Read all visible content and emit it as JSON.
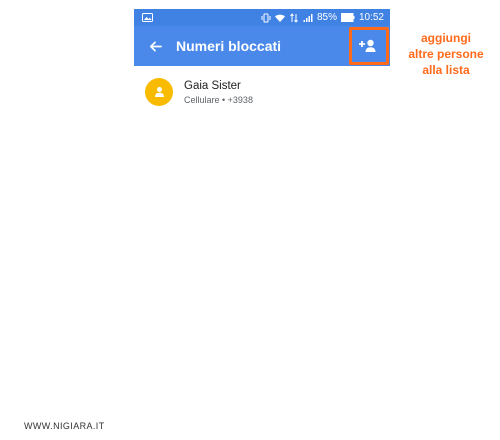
{
  "status_bar": {
    "battery": "85%",
    "time": "10:52",
    "icons": [
      "gallery-notification-icon",
      "vibrate-icon",
      "wifi-icon",
      "data-arrows-icon",
      "signal-icon",
      "battery-icon"
    ]
  },
  "app_bar": {
    "title": "Numeri bloccati",
    "back_icon": "arrow-back-icon",
    "action_icon": "person-add-icon"
  },
  "blocked_list": [
    {
      "name": "Gaia Sister",
      "detail": "Cellulare • +3938",
      "avatar_icon": "person-icon"
    }
  ],
  "annotation": {
    "lines": [
      "aggiungi",
      "altre persone",
      "alla lista"
    ]
  },
  "footer": {
    "watermark": "WWW.NIGIARA.IT"
  },
  "colors": {
    "status_bar": "#3f82e4",
    "app_bar": "#4a89ea",
    "avatar": "#f8bb00",
    "annotation": "#ff6a1b"
  }
}
